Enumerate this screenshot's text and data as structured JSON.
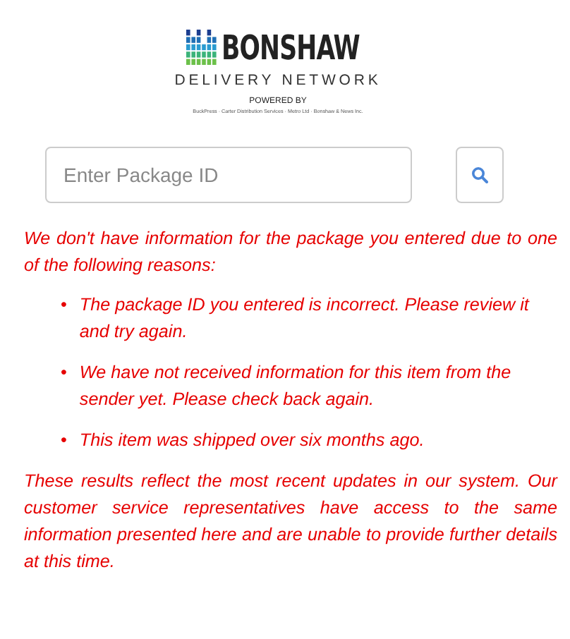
{
  "logo": {
    "name": "BONSHAW",
    "subtitle": "DELIVERY NETWORK",
    "powered_by": "POWERED BY",
    "partners": "BuckPress · Carter Distribution Services · Metro Ltd · Bonshaw & News Inc."
  },
  "search": {
    "placeholder": "Enter Package ID"
  },
  "message": {
    "intro": "We don't have information for the package you entered due to one of the following reasons:",
    "bullet": "•",
    "reasons": [
      "The package ID you entered is incorrect. Please review it and try again.",
      "We have not received information for this item from the sender yet. Please check back again.",
      "This item was shipped over six months ago."
    ],
    "footer": "These results reflect the most recent updates in our system. Our customer service representatives have access to the same information presented here and are unable to provide further details at this time."
  }
}
